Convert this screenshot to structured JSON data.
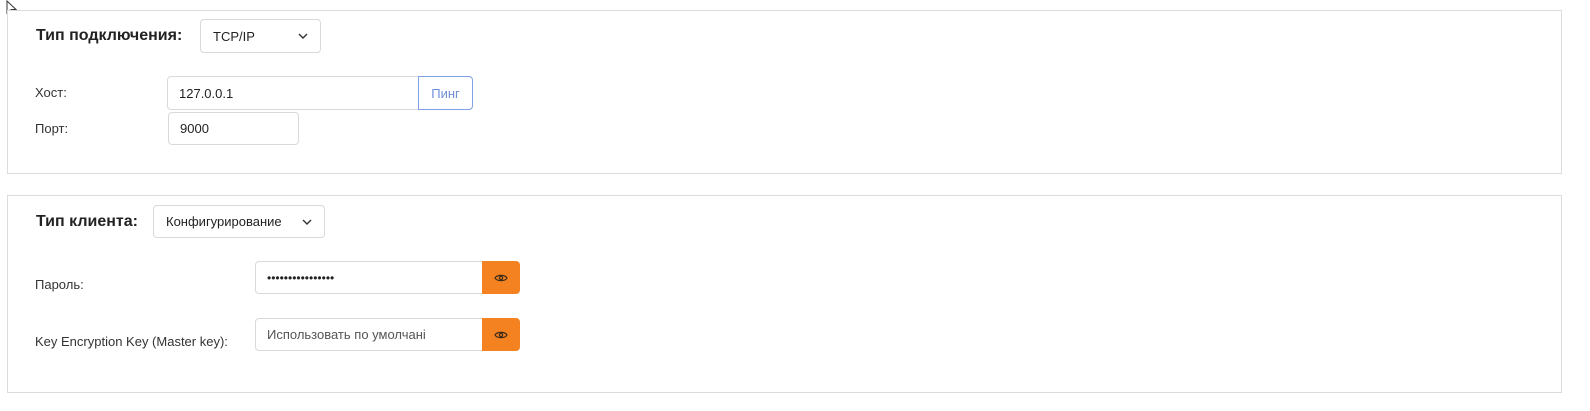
{
  "connection": {
    "heading": "Тип подключения:",
    "type_value": "TCP/IP",
    "host_label": "Хост:",
    "host_value": "127.0.0.1",
    "ping_label": "Пинг",
    "port_label": "Порт:",
    "port_value": "9000"
  },
  "client": {
    "heading": "Тип клиента:",
    "type_value": "Конфигурирование",
    "password_label": "Пароль:",
    "password_value": "••••••••••••••••",
    "kek_label": "Key Encryption Key (Master key):",
    "kek_placeholder": "Использовать по умолчані"
  },
  "colors": {
    "accent_orange": "#f58220",
    "ping_blue": "#6f8fd8",
    "border": "#dcdcdc"
  },
  "icons": {
    "dropdown": "chevron-down-icon",
    "toggle_visibility": "eye-icon",
    "cursor": "mouse-pointer-icon"
  }
}
